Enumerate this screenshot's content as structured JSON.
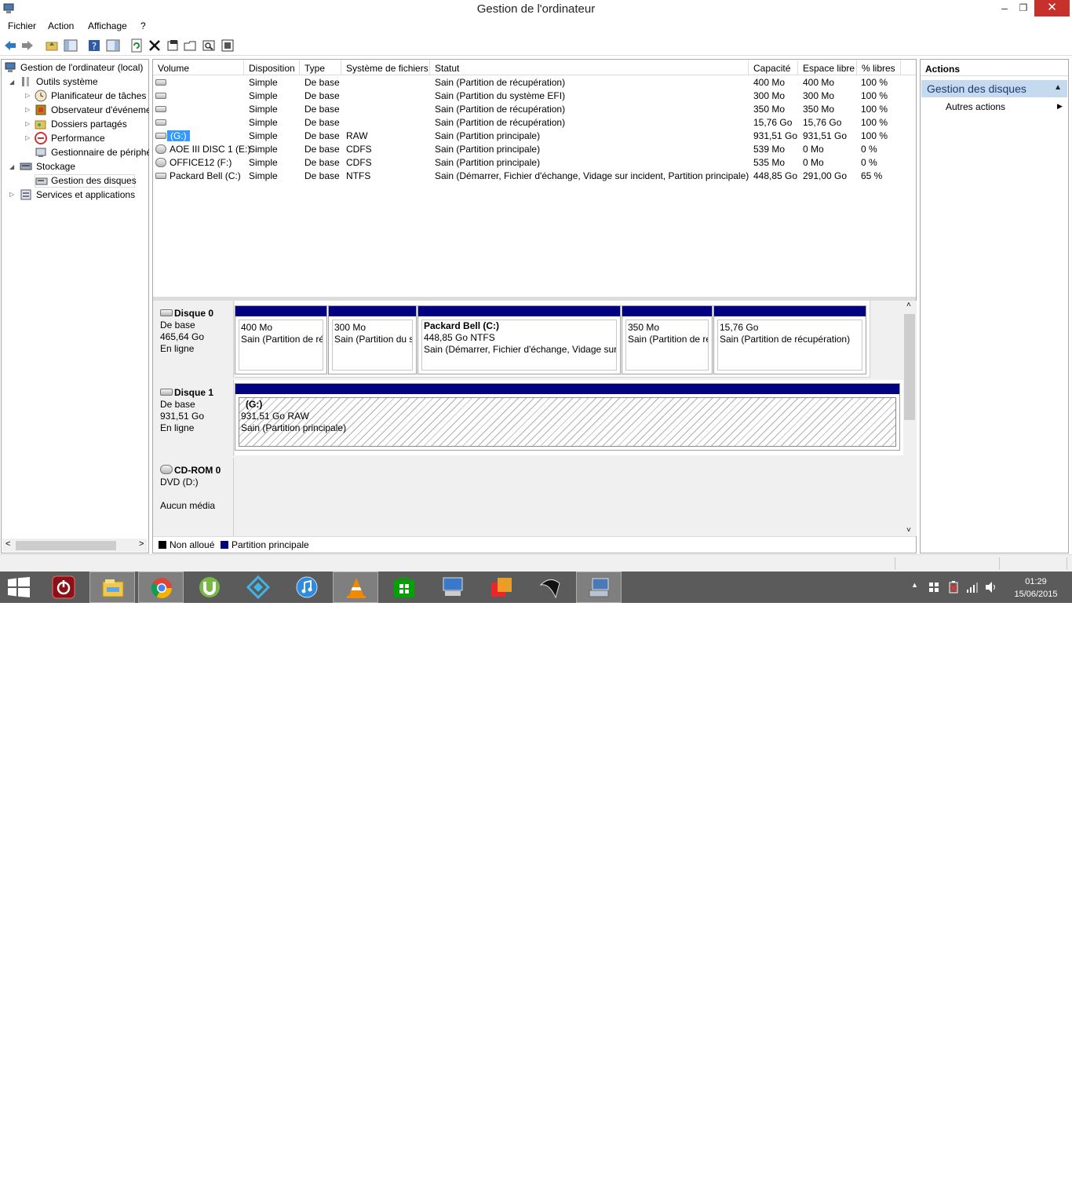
{
  "window": {
    "title": "Gestion de l'ordinateur",
    "min_glyph": "–",
    "max_glyph": "❐",
    "close_glyph": "✕"
  },
  "menu": [
    "Fichier",
    "Action",
    "Affichage",
    "?"
  ],
  "toolbar_icons": [
    "back-arrow-icon",
    "forward-arrow-icon",
    "up-folder-icon",
    "show-hide-tree-icon",
    "help-icon",
    "properties-pane-icon",
    "refresh-icon",
    "delete-icon",
    "properties-icon",
    "open-icon",
    "search-icon",
    "settings-icon"
  ],
  "tree": {
    "root": "Gestion de l'ordinateur (local)",
    "items": [
      {
        "label": "Outils système"
      },
      {
        "label": "Planificateur de tâches"
      },
      {
        "label": "Observateur d'événeme"
      },
      {
        "label": "Dossiers partagés"
      },
      {
        "label": "Performance"
      },
      {
        "label": "Gestionnaire de périphé"
      },
      {
        "label": "Stockage"
      },
      {
        "label": "Gestion des disques"
      },
      {
        "label": "Services et applications"
      }
    ]
  },
  "volumes": {
    "columns": [
      "Volume",
      "Disposition",
      "Type",
      "Système de fichiers",
      "Statut",
      "Capacité",
      "Espace libre",
      "% libres"
    ],
    "rows": [
      {
        "volume": "",
        "disposition": "Simple",
        "type": "De base",
        "fs": "",
        "status": "Sain (Partition de récupération)",
        "capacity": "400 Mo",
        "free": "400 Mo",
        "pct": "100 %"
      },
      {
        "volume": "",
        "disposition": "Simple",
        "type": "De base",
        "fs": "",
        "status": "Sain (Partition du système EFI)",
        "capacity": "300 Mo",
        "free": "300 Mo",
        "pct": "100 %"
      },
      {
        "volume": "",
        "disposition": "Simple",
        "type": "De base",
        "fs": "",
        "status": "Sain (Partition de récupération)",
        "capacity": "350 Mo",
        "free": "350 Mo",
        "pct": "100 %"
      },
      {
        "volume": "",
        "disposition": "Simple",
        "type": "De base",
        "fs": "",
        "status": "Sain (Partition de récupération)",
        "capacity": "15,76 Go",
        "free": "15,76 Go",
        "pct": "100 %"
      },
      {
        "volume": "(G:)",
        "disposition": "Simple",
        "type": "De base",
        "fs": "RAW",
        "status": "Sain (Partition principale)",
        "capacity": "931,51 Go",
        "free": "931,51 Go",
        "pct": "100 %"
      },
      {
        "volume": "AOE III DISC 1 (E:)",
        "disposition": "Simple",
        "type": "De base",
        "fs": "CDFS",
        "status": "Sain (Partition principale)",
        "capacity": "539 Mo",
        "free": "0 Mo",
        "pct": "0 %"
      },
      {
        "volume": "OFFICE12 (F:)",
        "disposition": "Simple",
        "type": "De base",
        "fs": "CDFS",
        "status": "Sain (Partition principale)",
        "capacity": "535 Mo",
        "free": "0 Mo",
        "pct": "0 %"
      },
      {
        "volume": "Packard Bell (C:)",
        "disposition": "Simple",
        "type": "De base",
        "fs": "NTFS",
        "status": "Sain (Démarrer, Fichier d'échange, Vidage sur incident, Partition principale)",
        "capacity": "448,85 Go",
        "free": "291,00 Go",
        "pct": "65 %"
      }
    ]
  },
  "disks": [
    {
      "name": "Disque 0",
      "type": "De base",
      "size": "465,64 Go",
      "state": "En ligne",
      "partitions": [
        {
          "title": "",
          "line1": "400 Mo",
          "line2": "Sain (Partition de ré"
        },
        {
          "title": "",
          "line1": "300 Mo",
          "line2": "Sain (Partition du s"
        },
        {
          "title": "Packard Bell  (C:)",
          "line1": "448,85 Go NTFS",
          "line2": "Sain (Démarrer, Fichier d'échange, Vidage sur i"
        },
        {
          "title": "",
          "line1": "350 Mo",
          "line2": "Sain (Partition de ré"
        },
        {
          "title": "",
          "line1": "15,76 Go",
          "line2": "Sain (Partition de récupération)"
        }
      ]
    },
    {
      "name": "Disque 1",
      "type": "De base",
      "size": "931,51 Go",
      "state": "En ligne",
      "partitions": [
        {
          "title": "(G:)",
          "line1": "931,51 Go RAW",
          "line2": "Sain (Partition principale)"
        }
      ]
    },
    {
      "name": "CD-ROM 0",
      "type": "DVD (D:)",
      "size": "",
      "state": "Aucun média",
      "partitions": []
    }
  ],
  "legend": [
    {
      "label": "Non alloué",
      "color": "#000000"
    },
    {
      "label": "Partition principale",
      "color": "#000080"
    }
  ],
  "actions": {
    "header": "Actions",
    "section": "Gestion des disques",
    "item": "Autres actions"
  },
  "taskbar": {
    "apps": [
      "windows-start-icon",
      "power-icon",
      "file-explorer-icon",
      "chrome-icon",
      "utorrent-icon",
      "app-icon",
      "itunes-icon",
      "vlc-icon",
      "store-icon",
      "keyboard-icon",
      "media-icon",
      "app-dark-icon",
      "computer-management-icon"
    ],
    "time": "01:29",
    "date": "15/06/2015"
  }
}
